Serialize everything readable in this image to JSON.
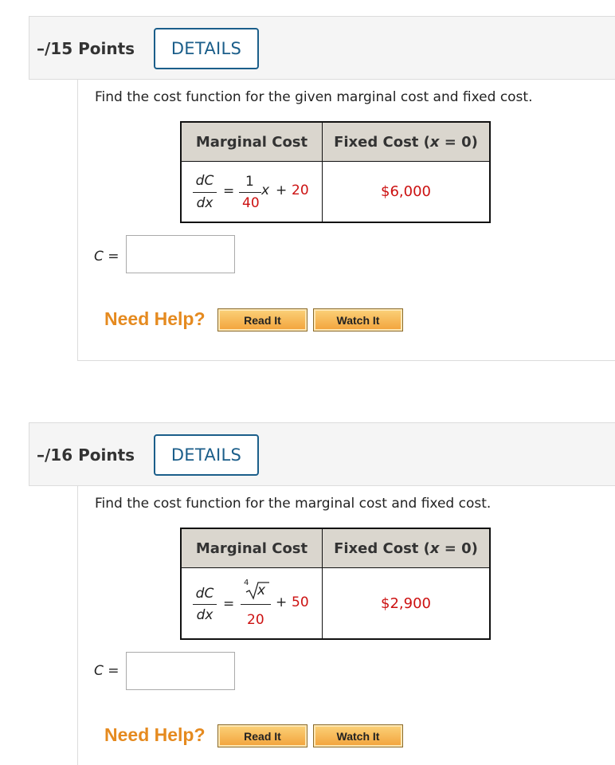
{
  "questions": [
    {
      "points": "–/15 Points",
      "details_label": "DETAILS",
      "prompt": "Find the cost function for the given marginal cost and fixed cost.",
      "table": {
        "col1_header": "Marginal Cost",
        "col2_header_prefix": "Fixed Cost (",
        "col2_header_var": "x",
        "col2_header_suffix": " = 0)",
        "mc_lhs_num": "dC",
        "mc_lhs_den": "dx",
        "mc_eq": "=",
        "mc_coef_num": "1",
        "mc_coef_den": "40",
        "mc_var": "x",
        "mc_plus": "+",
        "mc_const": "20",
        "fixed_cost": "$6,000"
      },
      "answer_label": "C",
      "answer_eq": "=",
      "answer_value": "",
      "need_help": "Need Help?",
      "read_it": "Read It",
      "watch_it": "Watch It"
    },
    {
      "points": "–/16 Points",
      "details_label": "DETAILS",
      "prompt": "Find the cost function for the marginal cost and fixed cost.",
      "table": {
        "col1_header": "Marginal Cost",
        "col2_header_prefix": "Fixed Cost (",
        "col2_header_var": "x",
        "col2_header_suffix": " = 0)",
        "mc_lhs_num": "dC",
        "mc_lhs_den": "dx",
        "mc_eq": "=",
        "mc_root_index": "4",
        "mc_root_var": "x",
        "mc_den": "20",
        "mc_plus": "+",
        "mc_const": "50",
        "fixed_cost": "$2,900"
      },
      "answer_label": "C",
      "answer_eq": "=",
      "answer_value": "",
      "need_help": "Need Help?",
      "read_it": "Read It",
      "watch_it": "Watch It"
    }
  ]
}
